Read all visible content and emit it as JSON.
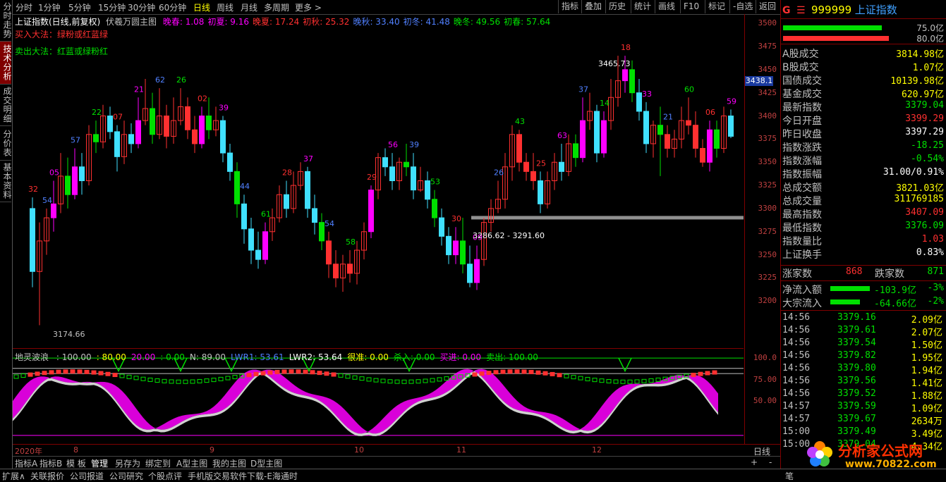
{
  "left_tabs": [
    "分时走势",
    "技术分析",
    "成交明细",
    "分价表",
    "基本资料"
  ],
  "left_tab_active": 1,
  "toolbar": {
    "periods": [
      "分时",
      "1分钟",
      "5分钟",
      "15分钟",
      "30分钟",
      "60分钟",
      "日线",
      "周线",
      "月线",
      "多周期",
      "更多 >"
    ],
    "active_period": 6,
    "right_buttons": [
      "指标",
      "叠加",
      "历史",
      "统计",
      "画线",
      "F10",
      "标记",
      "-自选",
      "返回"
    ]
  },
  "chart_header": {
    "title": "上证指数(日线,前复权)",
    "indicator_name": "伏羲万圆主图",
    "items": [
      {
        "label": "晚春: 1.08",
        "color": "#ff00ff"
      },
      {
        "label": "初夏: 9.16",
        "color": "#ff00ff"
      },
      {
        "label": "晚夏: 17.24",
        "color": "#ff3030"
      },
      {
        "label": "初秋: 25.32",
        "color": "#ff3030"
      },
      {
        "label": "晚秋: 33.40",
        "color": "#5080ff"
      },
      {
        "label": "初冬: 41.48",
        "color": "#5080ff"
      },
      {
        "label": "晚冬: 49.56",
        "color": "#00e000"
      },
      {
        "label": "初春: 57.64",
        "color": "#00e000"
      }
    ],
    "buy_rule": "买入大法：绿粉或红蓝绿",
    "sell_rule": "卖出大法：红蓝或绿粉红"
  },
  "annotations": {
    "high_label": "3465.73",
    "low_label": "3174.66",
    "range_label": "3286.62 - 3291.60",
    "price_marker": "3438.1"
  },
  "price_axis": [
    "3500",
    "3475",
    "3450",
    "3425",
    "3400",
    "3375",
    "3350",
    "3325",
    "3300",
    "3275",
    "3250",
    "3225",
    "3200"
  ],
  "indicator_header": {
    "name": "地灵波浪",
    "items": [
      {
        "label": ": 100.00",
        "color": "#c0c0c0"
      },
      {
        "label": ": 80.00",
        "color": "#ffff00"
      },
      {
        "label": "20.00",
        "color": "#ff00ff"
      },
      {
        "label": ": 0.00",
        "color": "#00e000"
      },
      {
        "label": "N: 89.00",
        "color": "#c0c0c0"
      },
      {
        "label": "LWR1: 53.61",
        "color": "#5080ff"
      },
      {
        "label": "LWR2: 53.64",
        "color": "#ffffff"
      },
      {
        "label": "很准: 0.00",
        "color": "#ffff00"
      },
      {
        "label": "杀入: 0.00",
        "color": "#00e000"
      },
      {
        "label": "买进: 0.00",
        "color": "#ff00ff"
      },
      {
        "label": "卖出: 100.00",
        "color": "#00e000"
      }
    ]
  },
  "indicator_axis": [
    "100.0",
    "75.00",
    "50.00"
  ],
  "x_axis": {
    "labels": [
      "2020年",
      "8",
      "9",
      "10",
      "11",
      "12"
    ],
    "period_label": "日线"
  },
  "bottom_tabs": [
    "指标A",
    "指标B",
    "模 板",
    "管理",
    "另存为",
    "绑定到",
    "A型主图",
    "我的主图",
    "D型主图"
  ],
  "bottom_tab_active": 3,
  "status_bar": [
    "扩展∧",
    "关联报价",
    "公司报道",
    "公司研究",
    "个股点评",
    "手机版交易软件下载-E海通时"
  ],
  "status_extra": "笔",
  "right_panel": {
    "code": "999999",
    "name": "上证指数",
    "depth_bars": [
      {
        "value": "75.0亿",
        "color": "#00e000"
      },
      {
        "value": "80.0亿",
        "color": "#ff3030"
      }
    ],
    "rows": [
      {
        "k": "A股成交",
        "v": "3814.98亿",
        "c": "#ffff00"
      },
      {
        "k": "B股成交",
        "v": "1.07亿",
        "c": "#ffff00"
      },
      {
        "k": "国债成交",
        "v": "10139.98亿",
        "c": "#ffff00"
      },
      {
        "k": "基金成交",
        "v": "620.97亿",
        "c": "#ffff00"
      },
      {
        "k": "最新指数",
        "v": "3379.04",
        "c": "#00e000"
      },
      {
        "k": "今日开盘",
        "v": "3399.29",
        "c": "#ff3030"
      },
      {
        "k": "昨日收盘",
        "v": "3397.29",
        "c": "#ffffff"
      },
      {
        "k": "指数涨跌",
        "v": "-18.25",
        "c": "#00e000"
      },
      {
        "k": "指数涨幅",
        "v": "-0.54%",
        "c": "#00e000"
      },
      {
        "k": "指数振幅",
        "v": "31.00/0.91%",
        "c": "#ffffff"
      },
      {
        "k": "总成交额",
        "v": "3821.03亿",
        "c": "#ffff00"
      },
      {
        "k": "总成交量",
        "v": "311769185",
        "c": "#ffff00"
      },
      {
        "k": "最高指数",
        "v": "3407.09",
        "c": "#ff3030"
      },
      {
        "k": "最低指数",
        "v": "3376.09",
        "c": "#00e000"
      },
      {
        "k": "指数量比",
        "v": "1.03",
        "c": "#ff3030"
      },
      {
        "k": "上证换手",
        "v": "0.83%",
        "c": "#ffffff"
      }
    ],
    "up_label": "涨家数",
    "up_value": "868",
    "down_label": "跌家数",
    "down_value": "871",
    "flows": [
      {
        "k": "净流入额",
        "v": "-103.9亿",
        "p": "-3%"
      },
      {
        "k": "大宗流入",
        "v": "-64.66亿",
        "p": "-2%"
      }
    ],
    "ticks": [
      {
        "t": "14:56",
        "p": "3379.16",
        "v": "2.09亿"
      },
      {
        "t": "14:56",
        "p": "3379.61",
        "v": "2.07亿"
      },
      {
        "t": "14:56",
        "p": "3379.54",
        "v": "1.50亿"
      },
      {
        "t": "14:56",
        "p": "3379.82",
        "v": "1.95亿"
      },
      {
        "t": "14:56",
        "p": "3379.80",
        "v": "1.94亿"
      },
      {
        "t": "14:56",
        "p": "3379.56",
        "v": "1.41亿"
      },
      {
        "t": "14:56",
        "p": "3379.52",
        "v": "1.88亿"
      },
      {
        "t": "14:57",
        "p": "3379.59",
        "v": "1.09亿"
      },
      {
        "t": "14:57",
        "p": "3379.67",
        "v": "2634万"
      },
      {
        "t": "15:00",
        "p": "3379.49",
        "v": "3.49亿"
      },
      {
        "t": "15:00",
        "p": "3379.04",
        "v": "4.34亿"
      }
    ]
  },
  "watermark": {
    "title": "分析家公式网",
    "url": "www.70822.com"
  },
  "chart_data": {
    "type": "candlestick",
    "x_range": [
      "2020-07",
      "2020-12"
    ],
    "y_range": [
      3150,
      3510
    ],
    "candles": [
      [
        3300,
        3232,
        3312,
        3215
      ],
      [
        3232,
        3265,
        3285,
        3174
      ],
      [
        3265,
        3290,
        3300,
        3250
      ],
      [
        3290,
        3305,
        3330,
        3275
      ],
      [
        3305,
        3335,
        3360,
        3295
      ],
      [
        3335,
        3315,
        3355,
        3300
      ],
      [
        3315,
        3345,
        3365,
        3310
      ],
      [
        3345,
        3330,
        3360,
        3315
      ],
      [
        3330,
        3380,
        3390,
        3325
      ],
      [
        3380,
        3372,
        3395,
        3360
      ],
      [
        3372,
        3400,
        3412,
        3365
      ],
      [
        3400,
        3383,
        3410,
        3375
      ],
      [
        3383,
        3356,
        3390,
        3340
      ],
      [
        3356,
        3380,
        3395,
        3348
      ],
      [
        3380,
        3370,
        3392,
        3360
      ],
      [
        3370,
        3395,
        3420,
        3365
      ],
      [
        3395,
        3408,
        3440,
        3390
      ],
      [
        3408,
        3380,
        3425,
        3370
      ],
      [
        3380,
        3400,
        3430,
        3375
      ],
      [
        3400,
        3378,
        3412,
        3365
      ],
      [
        3378,
        3395,
        3420,
        3370
      ],
      [
        3395,
        3410,
        3430,
        3390
      ],
      [
        3410,
        3385,
        3420,
        3375
      ],
      [
        3385,
        3370,
        3400,
        3360
      ],
      [
        3370,
        3400,
        3410,
        3365
      ],
      [
        3400,
        3385,
        3420,
        3375
      ],
      [
        3385,
        3395,
        3410,
        3378
      ],
      [
        3395,
        3360,
        3400,
        3350
      ],
      [
        3360,
        3340,
        3370,
        3330
      ],
      [
        3340,
        3305,
        3350,
        3290
      ],
      [
        3305,
        3278,
        3315,
        3262
      ],
      [
        3278,
        3255,
        3290,
        3240
      ],
      [
        3255,
        3245,
        3275,
        3235
      ],
      [
        3245,
        3275,
        3285,
        3240
      ],
      [
        3275,
        3290,
        3300,
        3265
      ],
      [
        3290,
        3315,
        3325,
        3285
      ],
      [
        3315,
        3300,
        3330,
        3290
      ],
      [
        3300,
        3325,
        3340,
        3295
      ],
      [
        3325,
        3340,
        3350,
        3320
      ],
      [
        3340,
        3300,
        3345,
        3290
      ],
      [
        3300,
        3285,
        3315,
        3272
      ],
      [
        3285,
        3265,
        3295,
        3255
      ],
      [
        3265,
        3240,
        3275,
        3225
      ],
      [
        3240,
        3225,
        3255,
        3215
      ],
      [
        3225,
        3240,
        3250,
        3210
      ],
      [
        3240,
        3230,
        3255,
        3220
      ],
      [
        3230,
        3255,
        3265,
        3218
      ],
      [
        3255,
        3275,
        3285,
        3245
      ],
      [
        3275,
        3320,
        3325,
        3268
      ],
      [
        3320,
        3355,
        3360,
        3310
      ],
      [
        3355,
        3345,
        3365,
        3335
      ],
      [
        3345,
        3330,
        3360,
        3320
      ],
      [
        3330,
        3350,
        3355,
        3320
      ],
      [
        3350,
        3345,
        3370,
        3335
      ],
      [
        3345,
        3320,
        3360,
        3310
      ],
      [
        3320,
        3330,
        3345,
        3318
      ],
      [
        3330,
        3310,
        3340,
        3300
      ],
      [
        3310,
        3290,
        3320,
        3280
      ],
      [
        3290,
        3270,
        3300,
        3260
      ],
      [
        3270,
        3250,
        3280,
        3240
      ],
      [
        3250,
        3265,
        3280,
        3240
      ],
      [
        3265,
        3240,
        3290,
        3230
      ],
      [
        3240,
        3220,
        3260,
        3215
      ],
      [
        3220,
        3245,
        3260,
        3212
      ],
      [
        3245,
        3285,
        3290,
        3238
      ],
      [
        3285,
        3300,
        3310,
        3275
      ],
      [
        3300,
        3310,
        3330,
        3295
      ],
      [
        3310,
        3345,
        3360,
        3300
      ],
      [
        3345,
        3380,
        3390,
        3330
      ],
      [
        3380,
        3350,
        3385,
        3340
      ],
      [
        3350,
        3340,
        3360,
        3330
      ],
      [
        3340,
        3330,
        3360,
        3320
      ],
      [
        3330,
        3305,
        3340,
        3295
      ],
      [
        3305,
        3330,
        3340,
        3300
      ],
      [
        3330,
        3350,
        3360,
        3320
      ],
      [
        3350,
        3340,
        3370,
        3330
      ],
      [
        3340,
        3370,
        3380,
        3335
      ],
      [
        3370,
        3355,
        3380,
        3345
      ],
      [
        3355,
        3395,
        3420,
        3350
      ],
      [
        3395,
        3405,
        3425,
        3385
      ],
      [
        3405,
        3360,
        3412,
        3350
      ],
      [
        3360,
        3395,
        3405,
        3355
      ],
      [
        3395,
        3420,
        3440,
        3385
      ],
      [
        3420,
        3438,
        3465,
        3410
      ],
      [
        3438,
        3450,
        3465,
        3425
      ],
      [
        3450,
        3425,
        3460,
        3415
      ],
      [
        3425,
        3405,
        3440,
        3395
      ],
      [
        3405,
        3370,
        3415,
        3360
      ],
      [
        3370,
        3390,
        3395,
        3355
      ],
      [
        3390,
        3380,
        3410,
        3335
      ],
      [
        3380,
        3365,
        3390,
        3355
      ],
      [
        3365,
        3375,
        3385,
        3355
      ],
      [
        3375,
        3395,
        3410,
        3365
      ],
      [
        3395,
        3390,
        3420,
        3380
      ],
      [
        3390,
        3365,
        3405,
        3355
      ],
      [
        3365,
        3350,
        3375,
        3345
      ],
      [
        3350,
        3385,
        3395,
        3340
      ],
      [
        3385,
        3365,
        3395,
        3355
      ],
      [
        3365,
        3400,
        3410,
        3360
      ],
      [
        3400,
        3378,
        3407,
        3376
      ]
    ]
  }
}
